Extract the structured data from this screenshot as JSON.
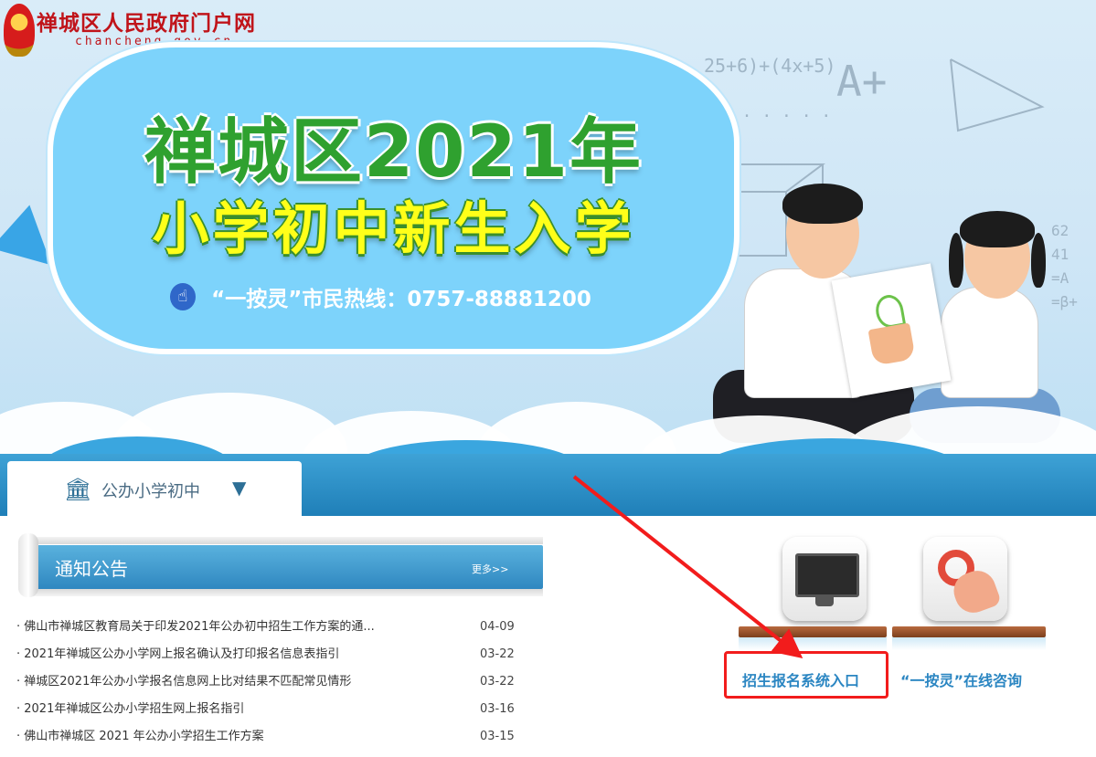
{
  "header": {
    "site_name": "禅城区人民政府门户网",
    "site_domain": "chancheng.gov.cn"
  },
  "banner": {
    "title_line1": "禅城区2021年",
    "title_line2": "小学初中新生入学",
    "hotline": "“一按灵”市民热线：0757-88881200"
  },
  "tabs": [
    {
      "label": "公办小学初中",
      "active": true
    }
  ],
  "notice": {
    "title": "通知公告",
    "more_label": "更多>>",
    "items": [
      {
        "title": "· 佛山市禅城区教育局关于印发2021年公办初中招生工作方案的通...",
        "date": "04-09"
      },
      {
        "title": "· 2021年禅城区公办小学网上报名确认及打印报名信息表指引",
        "date": "03-22"
      },
      {
        "title": "· 禅城区2021年公办小学报名信息网上比对结果不匹配常见情形",
        "date": "03-22"
      },
      {
        "title": "· 2021年禅城区公办小学招生网上报名指引",
        "date": "03-16"
      },
      {
        "title": "· 佛山市禅城区 2021 年公办小学招生工作方案",
        "date": "03-15"
      }
    ]
  },
  "entries": [
    {
      "label": "招生报名系统入口",
      "icon": "monitor-icon"
    },
    {
      "label": "“一按灵”在线咨询",
      "icon": "touch-icon"
    }
  ],
  "colors": {
    "brand_red": "#c0141a",
    "tab_blue": "#2f87c0",
    "entry_blue": "#2b86c2",
    "highlight_red": "#f21c1c"
  }
}
